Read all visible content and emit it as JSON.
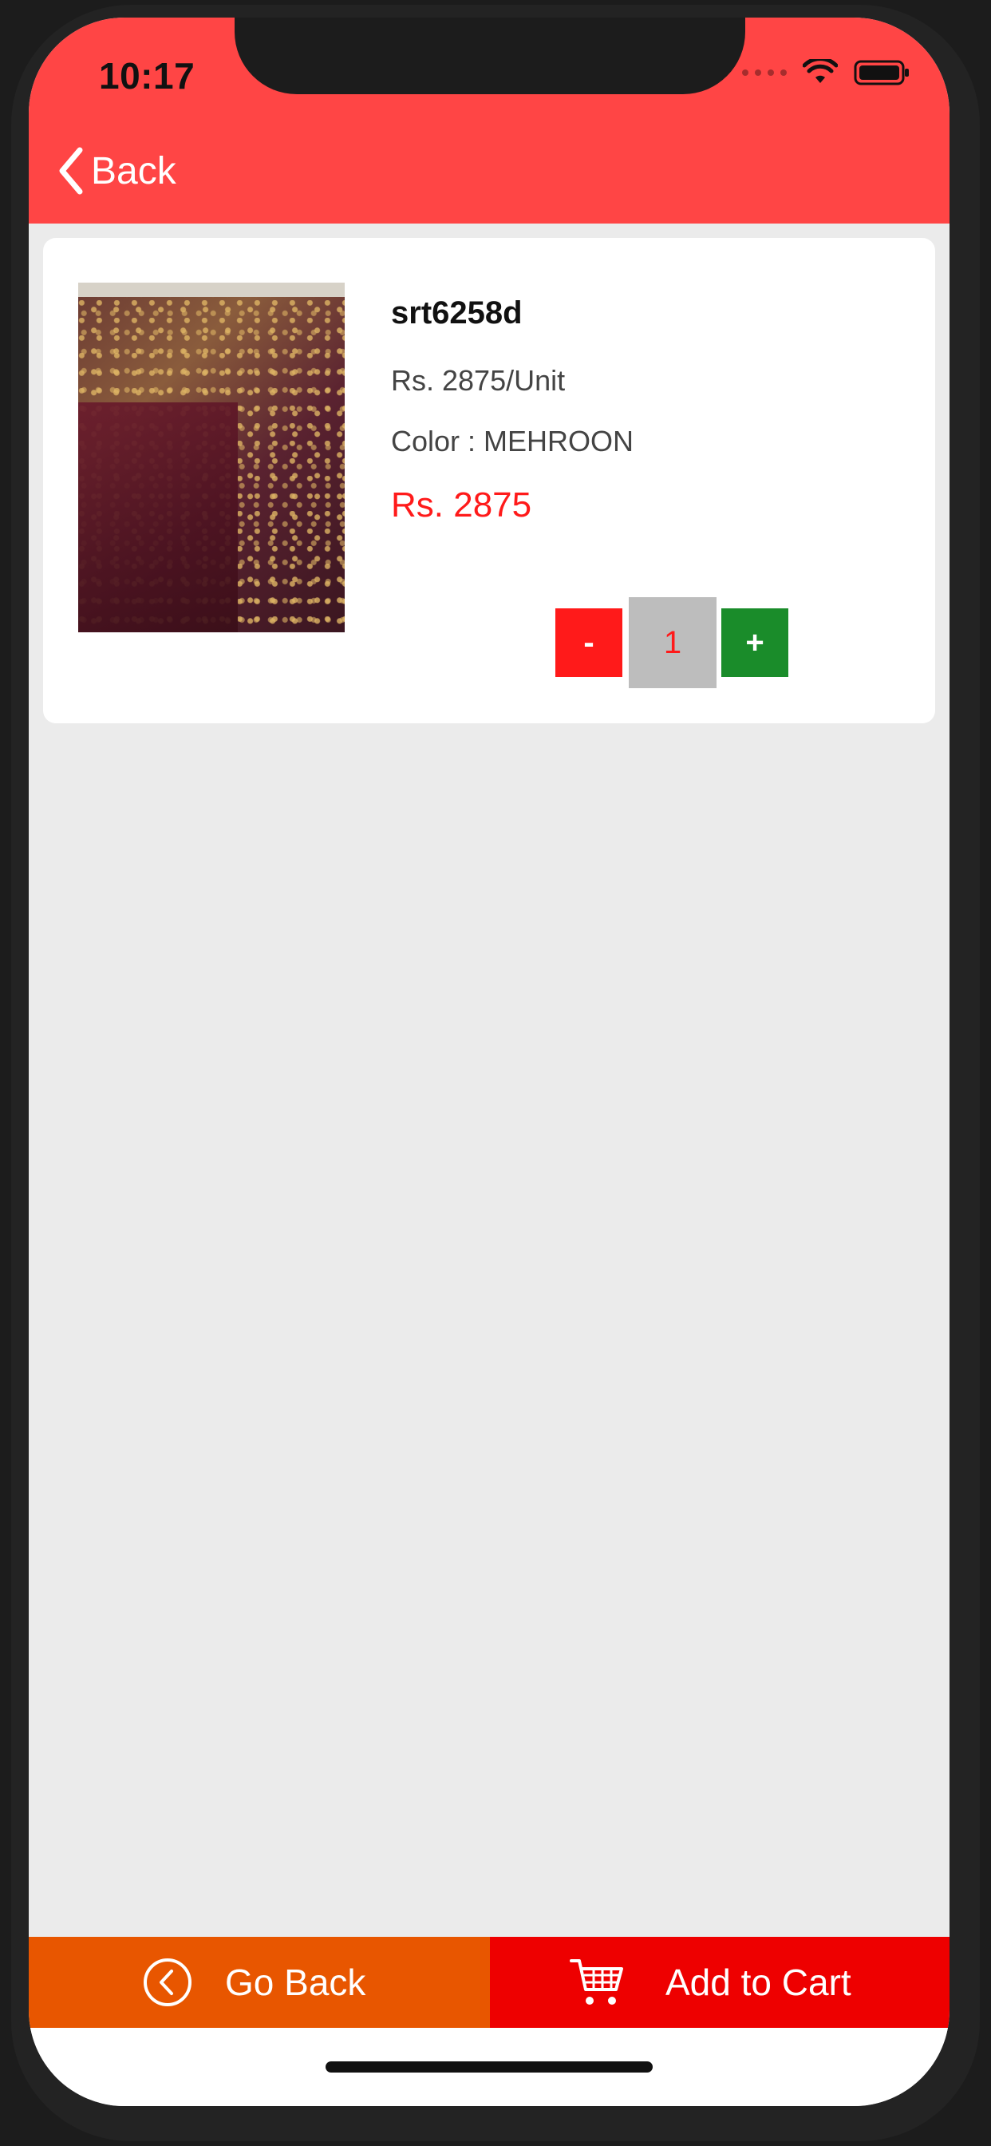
{
  "status_bar": {
    "time": "10:17"
  },
  "nav": {
    "back_label": "Back"
  },
  "product": {
    "code": "srt6258d",
    "unit_price": "Rs. 2875/Unit",
    "color_line": "Color : MEHROON",
    "total_price": "Rs. 2875",
    "image_icon": "product-photo"
  },
  "quantity": {
    "minus_label": "-",
    "value": "1",
    "plus_label": "+"
  },
  "bottom_bar": {
    "go_back_label": "Go Back",
    "go_back_icon": "circle-chevron-left-icon",
    "add_to_cart_label": "Add to Cart",
    "add_to_cart_icon": "cart-icon"
  },
  "colors": {
    "header": "#ff4545",
    "go_back": "#e85600",
    "add_to_cart": "#ee0000",
    "minus": "#ff1a1a",
    "plus": "#1a8c2a",
    "price": "#ff1a1a"
  }
}
